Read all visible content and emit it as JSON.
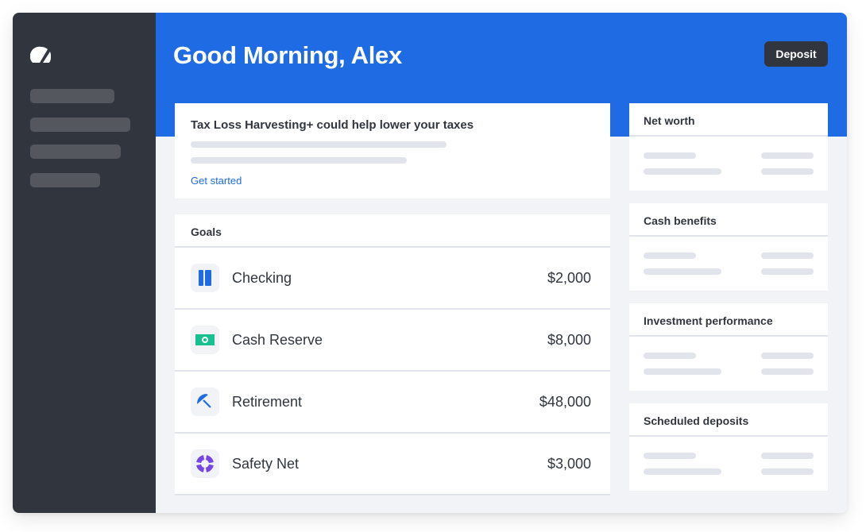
{
  "sidebar": {
    "logo_icon": "logo-slash-circle-icon",
    "placeholder_items": 4
  },
  "header": {
    "greeting": "Good Morning, Alex",
    "deposit_label": "Deposit"
  },
  "promo": {
    "title": "Tax Loss Harvesting+ could help lower your taxes",
    "cta": "Get started"
  },
  "goals": {
    "title": "Goals",
    "items": [
      {
        "name": "Checking",
        "amount": "$2,000",
        "icon": "checking-card-icon",
        "color": "#1e6be3"
      },
      {
        "name": "Cash Reserve",
        "amount": "$8,000",
        "icon": "cash-bill-icon",
        "color": "#17c08f"
      },
      {
        "name": "Retirement",
        "amount": "$48,000",
        "icon": "umbrella-icon",
        "color": "#1e6be3"
      },
      {
        "name": "Safety Net",
        "amount": "$3,000",
        "icon": "life-ring-icon",
        "color": "#7545e6"
      }
    ]
  },
  "side_cards": [
    {
      "title": "Net worth"
    },
    {
      "title": "Cash benefits"
    },
    {
      "title": "Investment performance"
    },
    {
      "title": "Scheduled deposits"
    }
  ],
  "colors": {
    "brand_blue": "#1e6be3",
    "sidebar_dark": "#31363e",
    "background": "#f2f3f7",
    "skeleton": "#e1e4ea"
  }
}
